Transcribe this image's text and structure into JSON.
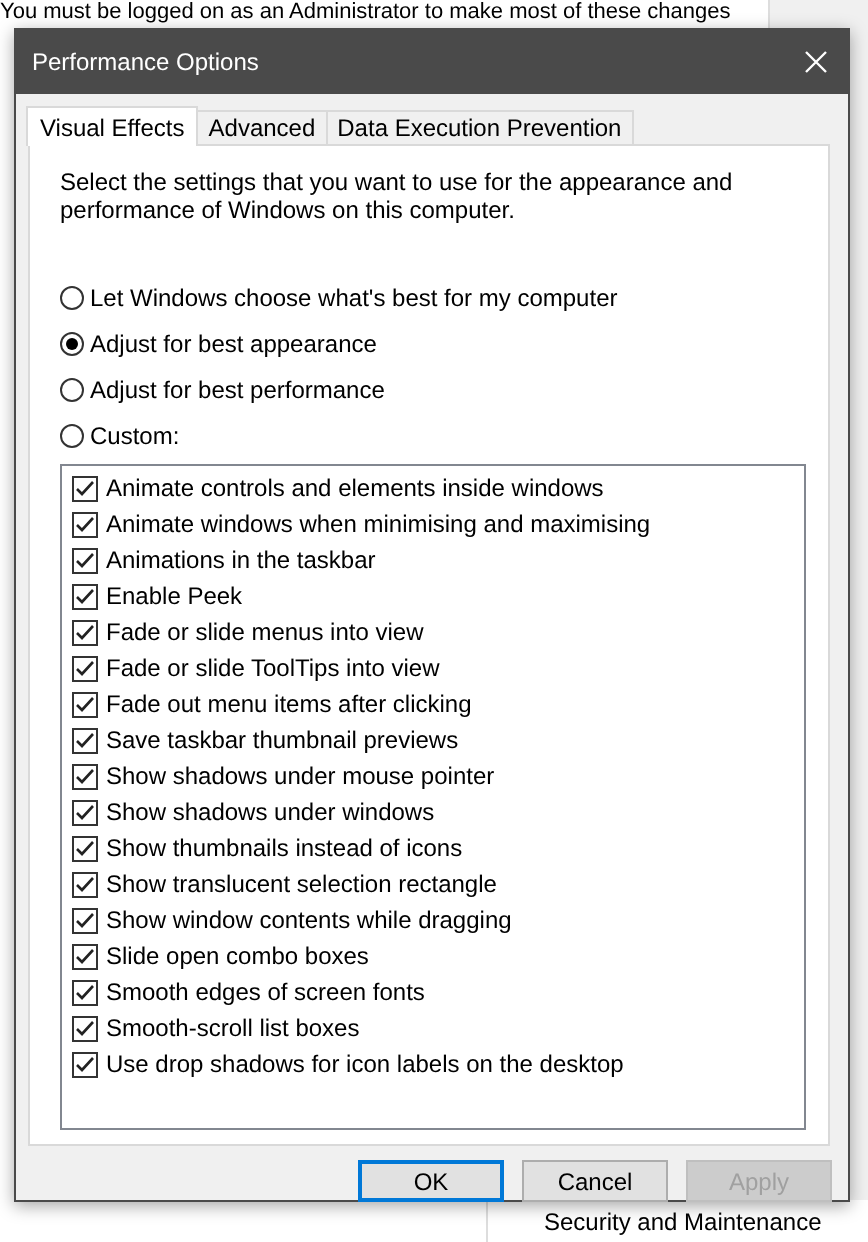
{
  "background": {
    "notice": "You must be logged on as an Administrator to make most of these changes",
    "link": "Security and Maintenance"
  },
  "window": {
    "title": "Performance Options"
  },
  "tabs": [
    {
      "label": "Visual Effects",
      "selected": true
    },
    {
      "label": "Advanced",
      "selected": false
    },
    {
      "label": "Data Execution Prevention",
      "selected": false
    }
  ],
  "description": "Select the settings that you want to use for the appearance and performance of Windows on this computer.",
  "options": [
    {
      "label": "Let Windows choose what's best for my computer",
      "selected": false
    },
    {
      "label": "Adjust for best appearance",
      "selected": true
    },
    {
      "label": "Adjust for best performance",
      "selected": false
    },
    {
      "label": "Custom:",
      "selected": false
    }
  ],
  "effects": [
    {
      "label": "Animate controls and elements inside windows",
      "checked": true
    },
    {
      "label": "Animate windows when minimising and maximising",
      "checked": true
    },
    {
      "label": "Animations in the taskbar",
      "checked": true
    },
    {
      "label": "Enable Peek",
      "checked": true
    },
    {
      "label": "Fade or slide menus into view",
      "checked": true
    },
    {
      "label": "Fade or slide ToolTips into view",
      "checked": true
    },
    {
      "label": "Fade out menu items after clicking",
      "checked": true
    },
    {
      "label": "Save taskbar thumbnail previews",
      "checked": true
    },
    {
      "label": "Show shadows under mouse pointer",
      "checked": true
    },
    {
      "label": "Show shadows under windows",
      "checked": true
    },
    {
      "label": "Show thumbnails instead of icons",
      "checked": true
    },
    {
      "label": "Show translucent selection rectangle",
      "checked": true
    },
    {
      "label": "Show window contents while dragging",
      "checked": true
    },
    {
      "label": "Slide open combo boxes",
      "checked": true
    },
    {
      "label": "Smooth edges of screen fonts",
      "checked": true
    },
    {
      "label": "Smooth-scroll list boxes",
      "checked": true
    },
    {
      "label": "Use drop shadows for icon labels on the desktop",
      "checked": true
    }
  ],
  "buttons": [
    {
      "label": "OK",
      "default": true,
      "disabled": false
    },
    {
      "label": "Cancel",
      "default": false,
      "disabled": false
    },
    {
      "label": "Apply",
      "default": false,
      "disabled": true
    }
  ]
}
